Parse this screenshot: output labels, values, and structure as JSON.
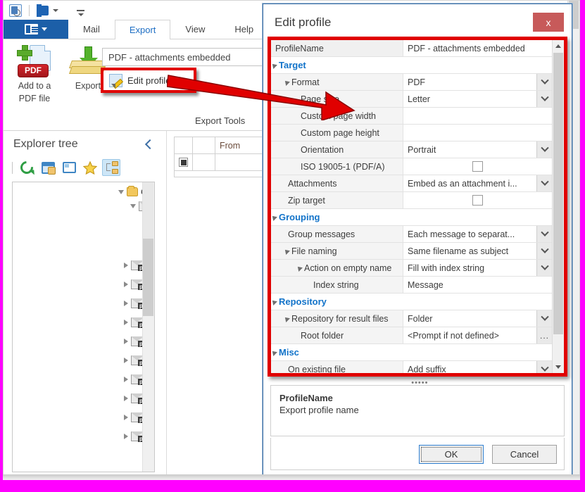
{
  "quick_access": {
    "items": [
      {
        "name": "outlook-icon",
        "label": ""
      },
      {
        "name": "office-icon",
        "label": ""
      },
      {
        "name": "customize-qat-icon",
        "label": ""
      }
    ]
  },
  "ribbon": {
    "file_button_label": "",
    "tabs": [
      {
        "label": "Mail",
        "active": false
      },
      {
        "label": "Export",
        "active": true
      },
      {
        "label": "View",
        "active": false
      },
      {
        "label": "Help",
        "active": false
      }
    ],
    "buttons": [
      {
        "label_line1": "Add to a",
        "label_line2": "PDF file",
        "icon": "add-to-pdf-icon"
      },
      {
        "label_line1": "Export",
        "label_line2": "",
        "icon": "export-icon"
      }
    ],
    "profile_combo_value": "PDF - attachments embedded",
    "edit_profile_label": "Edit profile",
    "group_label": "Export Tools"
  },
  "explorer": {
    "title": "Explorer tree",
    "collapse_icon": "chevron-left-icon",
    "toolbar": [
      {
        "name": "refresh-icon"
      },
      {
        "name": "window-hand-icon"
      },
      {
        "name": "card-view-icon"
      },
      {
        "name": "favorites-star-icon"
      },
      {
        "name": "tree-view-icon"
      }
    ],
    "tree": [
      {
        "label": "Ou",
        "icon": "folder-icon",
        "indent": 0,
        "expanded": true
      },
      {
        "label": "",
        "icon": "mail-p-icon",
        "indent": 1,
        "expanded": true
      }
    ],
    "more_items_icon": "mail-p-icon",
    "more_items_count": 10
  },
  "message_list": {
    "columns": [
      "",
      "",
      "From"
    ],
    "rows": [
      {
        "marker": "square-marker-icon",
        "cells": [
          "",
          "",
          ""
        ]
      }
    ]
  },
  "dialog": {
    "title": "Edit profile",
    "close_label": "x",
    "rows": [
      {
        "type": "prop",
        "indent": 0,
        "name": "ProfileName",
        "value": "PDF - attachments embedded",
        "editor": "none",
        "header": true
      },
      {
        "type": "cat",
        "indent": 0,
        "name": "Target",
        "value": "",
        "editor": "none",
        "expanded": true
      },
      {
        "type": "prop",
        "indent": 1,
        "name": "Format",
        "value": "PDF",
        "editor": "dropdown",
        "expanded": true
      },
      {
        "type": "prop",
        "indent": 2,
        "name": "Page size",
        "value": "Letter",
        "editor": "dropdown"
      },
      {
        "type": "prop",
        "indent": 2,
        "name": "Custom page width",
        "value": "",
        "editor": "none"
      },
      {
        "type": "prop",
        "indent": 2,
        "name": "Custom page height",
        "value": "",
        "editor": "none"
      },
      {
        "type": "prop",
        "indent": 2,
        "name": "Orientation",
        "value": "Portrait",
        "editor": "dropdown"
      },
      {
        "type": "prop",
        "indent": 2,
        "name": "ISO 19005-1 (PDF/A)",
        "value": "",
        "editor": "checkbox",
        "checked": false
      },
      {
        "type": "prop",
        "indent": 1,
        "name": "Attachments",
        "value": "Embed as an attachment i...",
        "editor": "dropdown"
      },
      {
        "type": "prop",
        "indent": 1,
        "name": "Zip target",
        "value": "",
        "editor": "checkbox",
        "checked": false
      },
      {
        "type": "cat",
        "indent": 0,
        "name": "Grouping",
        "value": "",
        "editor": "none",
        "expanded": true
      },
      {
        "type": "prop",
        "indent": 1,
        "name": "Group messages",
        "value": "Each message to separat...",
        "editor": "dropdown"
      },
      {
        "type": "prop",
        "indent": 1,
        "name": "File naming",
        "value": "Same filename as subject",
        "editor": "dropdown",
        "expanded": true
      },
      {
        "type": "prop",
        "indent": 2,
        "name": "Action on empty name",
        "value": "Fill with index string",
        "editor": "dropdown",
        "expanded": true
      },
      {
        "type": "prop",
        "indent": 3,
        "name": "Index string",
        "value": "Message",
        "editor": "none"
      },
      {
        "type": "cat",
        "indent": 0,
        "name": "Repository",
        "value": "",
        "editor": "none",
        "expanded": true
      },
      {
        "type": "prop",
        "indent": 1,
        "name": "Repository for result files",
        "value": "Folder",
        "editor": "dropdown",
        "expanded": true
      },
      {
        "type": "prop",
        "indent": 2,
        "name": "Root folder",
        "value": "<Prompt if not defined>",
        "editor": "browse"
      },
      {
        "type": "cat",
        "indent": 0,
        "name": "Misc",
        "value": "",
        "editor": "none",
        "expanded": true
      },
      {
        "type": "prop",
        "indent": 1,
        "name": "On existing file",
        "value": "Add suffix",
        "editor": "dropdown"
      }
    ],
    "splitter_glyph": "•••••",
    "description": {
      "title": "ProfileName",
      "body": "Export profile name"
    },
    "buttons": {
      "ok": "OK",
      "cancel": "Cancel"
    }
  },
  "colors": {
    "accent_blue": "#1c5fa8",
    "tab_active_text": "#1f6fc4",
    "callout_red": "#e00000",
    "category_blue": "#1273c9",
    "close_red": "#c75a5a",
    "outer_border_magenta": "#ff00ff"
  }
}
